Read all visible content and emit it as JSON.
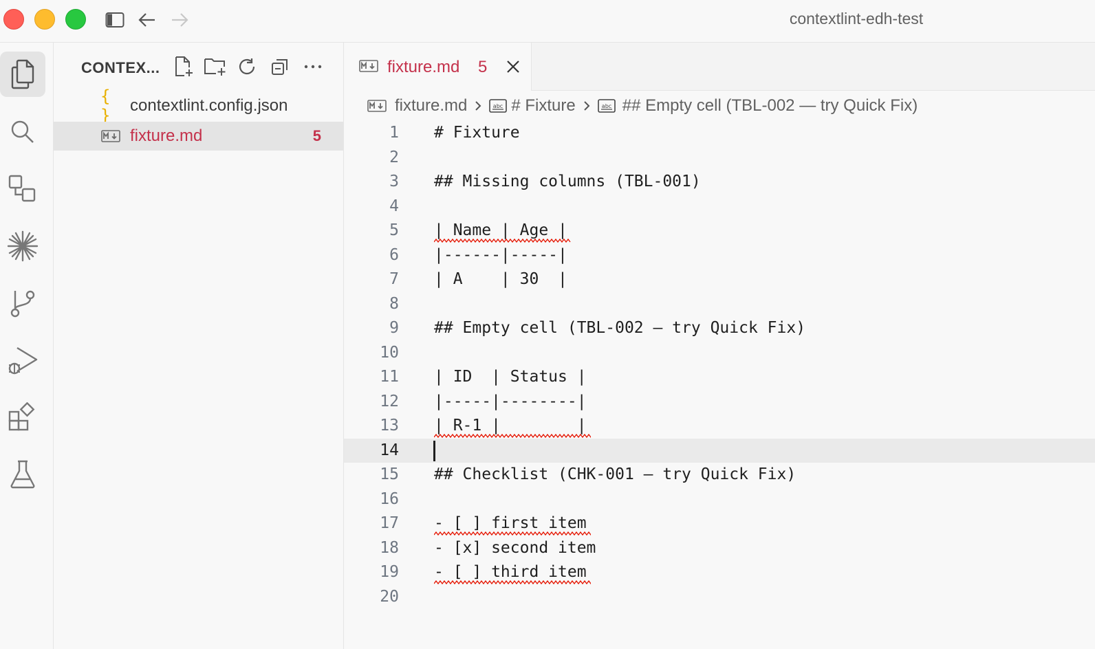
{
  "window": {
    "title": "contextlint-edh-test"
  },
  "explorer": {
    "title": "CONTEX...",
    "files": [
      {
        "name": "contextlint.config.json",
        "icon": "json-braces-icon",
        "badge": ""
      },
      {
        "name": "fixture.md",
        "icon": "markdown-icon",
        "badge": "5"
      }
    ]
  },
  "tab": {
    "label": "fixture.md",
    "problems": "5"
  },
  "breadcrumb": {
    "file": "fixture.md",
    "sections": [
      "# Fixture",
      "## Empty cell (TBL-002 — try Quick Fix)"
    ]
  },
  "editor": {
    "current_line": 14,
    "lines": [
      {
        "n": "1",
        "text": "# Fixture"
      },
      {
        "n": "2",
        "text": ""
      },
      {
        "n": "3",
        "text": "## Missing columns (TBL-001)"
      },
      {
        "n": "4",
        "text": ""
      },
      {
        "n": "5",
        "text": "| Name | Age |"
      },
      {
        "n": "6",
        "text": "|------|-----|"
      },
      {
        "n": "7",
        "text": "| A    | 30  |"
      },
      {
        "n": "8",
        "text": ""
      },
      {
        "n": "9",
        "text": "## Empty cell (TBL-002 — try Quick Fix)"
      },
      {
        "n": "10",
        "text": ""
      },
      {
        "n": "11",
        "text": "| ID  | Status |"
      },
      {
        "n": "12",
        "text": "|-----|--------|"
      },
      {
        "n": "13",
        "text": "| R-1 |        |"
      },
      {
        "n": "14",
        "text": ""
      },
      {
        "n": "15",
        "text": "## Checklist (CHK-001 — try Quick Fix)"
      },
      {
        "n": "16",
        "text": ""
      },
      {
        "n": "17",
        "text": "- [ ] first item"
      },
      {
        "n": "18",
        "text": "- [x] second item"
      },
      {
        "n": "19",
        "text": "- [ ] third item"
      },
      {
        "n": "20",
        "text": ""
      }
    ]
  },
  "colors": {
    "error": "#c4314b",
    "squiggle": "#e51400",
    "json_icon": "#e8b000"
  }
}
